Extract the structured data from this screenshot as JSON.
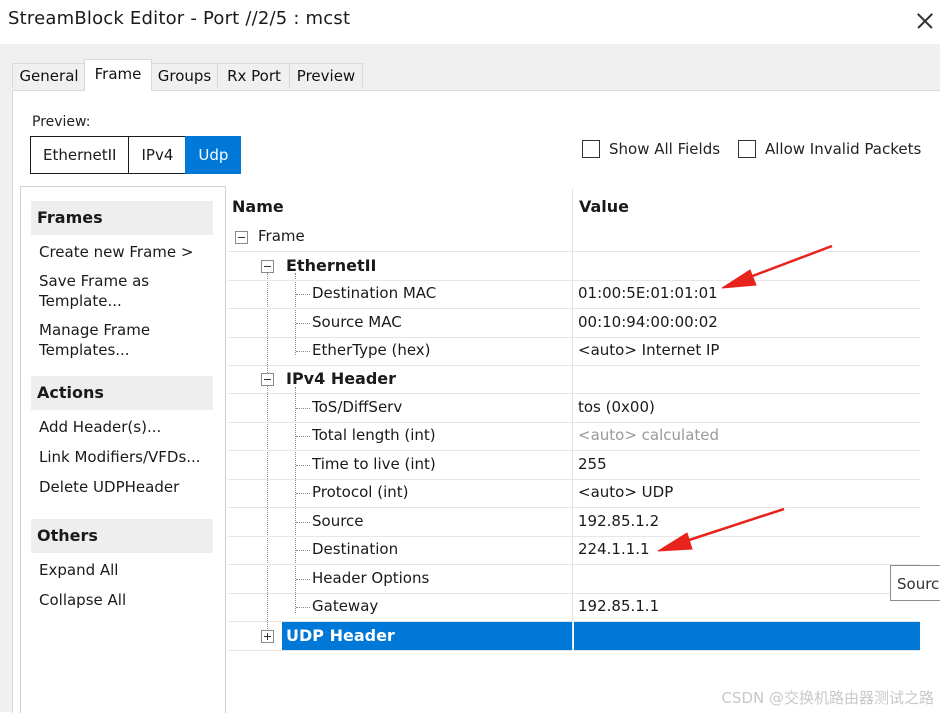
{
  "window": {
    "title": "StreamBlock Editor - Port //2/5 : mcst"
  },
  "tabs": [
    "General",
    "Frame",
    "Groups",
    "Rx Port",
    "Preview"
  ],
  "preview": {
    "label": "Preview:",
    "crumbs": [
      "EthernetII",
      "IPv4",
      "Udp"
    ],
    "selected_crumb": "Udp"
  },
  "options": {
    "show_all_fields": "Show All Fields",
    "allow_invalid": "Allow Invalid Packets"
  },
  "sidebar": {
    "frames": {
      "title": "Frames",
      "items": [
        "Create new Frame >",
        "Save Frame as Template...",
        "Manage Frame Templates..."
      ]
    },
    "actions": {
      "title": "Actions",
      "items": [
        "Add Header(s)...",
        "Link Modifiers/VFDs...",
        "Delete UDPHeader"
      ]
    },
    "others": {
      "title": "Others",
      "items": [
        "Expand All",
        "Collapse All"
      ]
    }
  },
  "grid": {
    "col_name": "Name",
    "col_value": "Value",
    "rows": [
      {
        "name": "Frame",
        "value": ""
      },
      {
        "name": "EthernetII",
        "value": ""
      },
      {
        "name": "Destination MAC",
        "value": "01:00:5E:01:01:01"
      },
      {
        "name": "Source MAC",
        "value": "00:10:94:00:00:02"
      },
      {
        "name": "EtherType (hex)",
        "value": "<auto> Internet IP"
      },
      {
        "name": "IPv4 Header",
        "value": ""
      },
      {
        "name": "ToS/DiffServ",
        "value": "tos (0x00)"
      },
      {
        "name": "Total length (int)",
        "value": "<auto> calculated"
      },
      {
        "name": "Time to live (int)",
        "value": "255"
      },
      {
        "name": "Protocol (int)",
        "value": "<auto> UDP"
      },
      {
        "name": "Source",
        "value": "192.85.1.2"
      },
      {
        "name": "Destination",
        "value": "224.1.1.1"
      },
      {
        "name": "Header Options",
        "value": ""
      },
      {
        "name": "Gateway",
        "value": "192.85.1.1"
      },
      {
        "name": "UDP Header",
        "value": ""
      }
    ]
  },
  "tooltip": {
    "text": "Source"
  },
  "watermark": "CSDN @交换机路由器测试之路",
  "colors": {
    "selection": "#0078d7",
    "annotation_arrow": "#e8231c"
  }
}
